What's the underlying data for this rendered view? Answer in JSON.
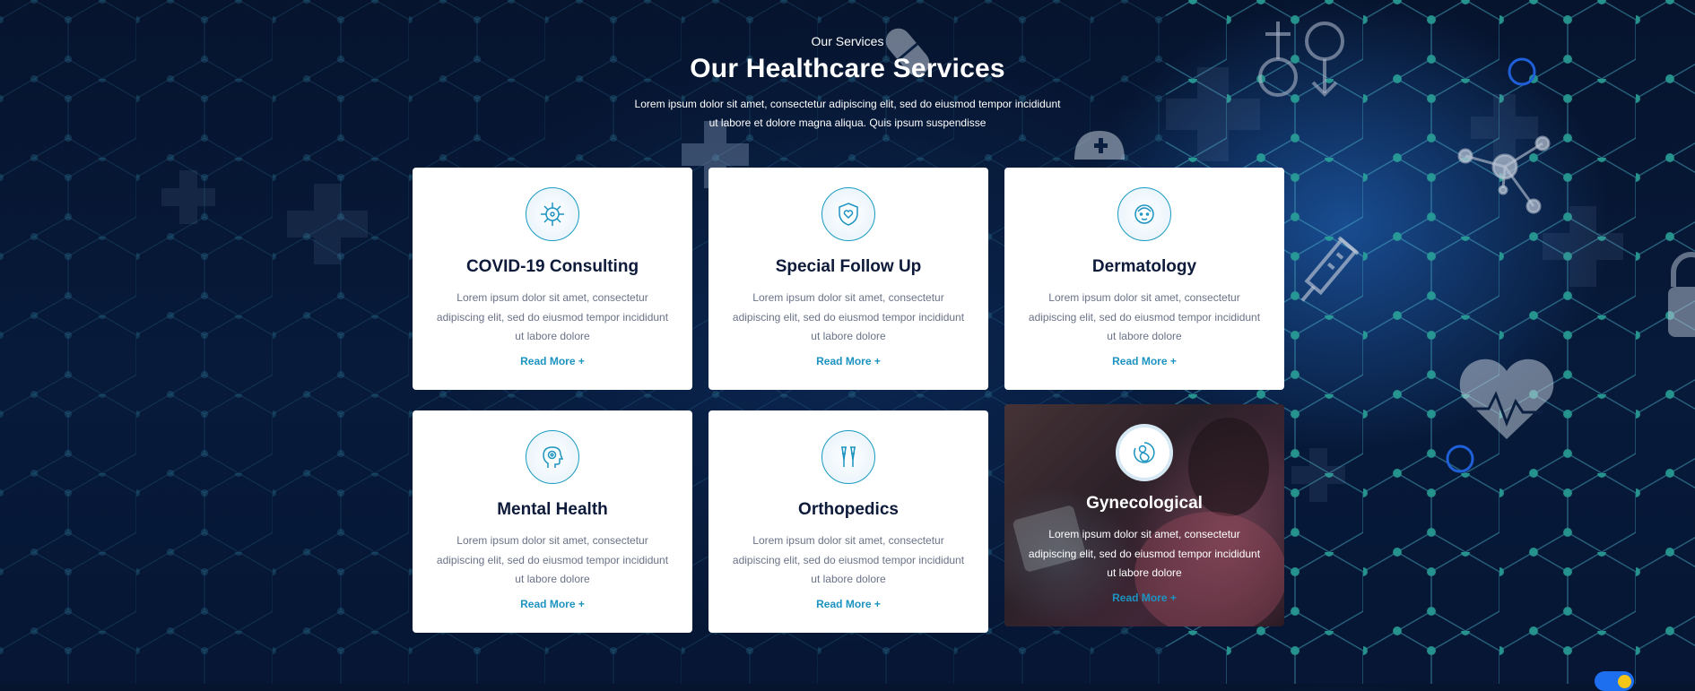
{
  "section": {
    "eyebrow": "Our Services",
    "heading": "Our Healthcare Services",
    "intro_line1": "Lorem ipsum dolor sit amet, consectetur adipiscing elit, sed do eiusmod tempor incididunt",
    "intro_line2": "ut labore et dolore magna aliqua. Quis ipsum suspendisse"
  },
  "cards": [
    {
      "title": "COVID-19 Consulting",
      "icon": "virus-icon",
      "description": "Lorem ipsum dolor sit amet, consectetur adipiscing elit, sed do eiusmod tempor incididunt ut labore dolore",
      "link": "Read More +"
    },
    {
      "title": "Special Follow Up",
      "icon": "shield-icon",
      "description": "Lorem ipsum dolor sit amet, consectetur adipiscing elit, sed do eiusmod tempor incididunt ut labore dolore",
      "link": "Read More +"
    },
    {
      "title": "Dermatology",
      "icon": "face-icon",
      "description": "Lorem ipsum dolor sit amet, consectetur adipiscing elit, sed do eiusmod tempor incididunt ut labore dolore",
      "link": "Read More +"
    },
    {
      "title": "Mental Health",
      "icon": "head-brain-icon",
      "description": "Lorem ipsum dolor sit amet, consectetur adipiscing elit, sed do eiusmod tempor incididunt ut labore dolore",
      "link": "Read More +"
    },
    {
      "title": "Orthopedics",
      "icon": "crutches-icon",
      "description": "Lorem ipsum dolor sit amet, consectetur adipiscing elit, sed do eiusmod tempor incididunt ut labore dolore",
      "link": "Read More +"
    },
    {
      "title": "Gynecological",
      "icon": "fetus-icon",
      "description": "Lorem ipsum dolor sit amet, consectetur adipiscing elit, sed do eiusmod tempor incididunt ut labore dolore",
      "link": "Read More +"
    }
  ],
  "colors": {
    "accent": "#1c93c0",
    "background": "#071a3a",
    "card_title": "#0d1a3a",
    "card_text": "#6a7287"
  },
  "widgets": {
    "theme_toggle_icon": "sun-icon"
  }
}
